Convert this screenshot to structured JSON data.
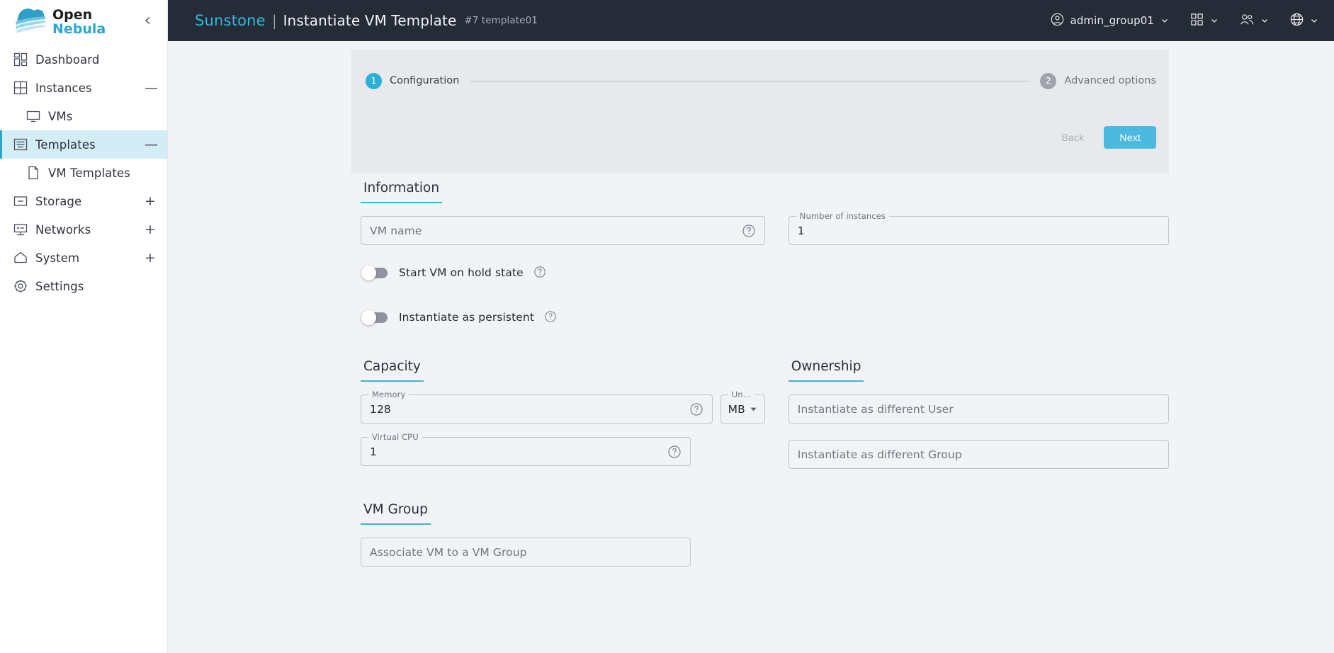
{
  "colors": {
    "accent": "#2ab0d6",
    "accent_button": "#4cb9e0",
    "brand_text": "#30b9dd",
    "topbar_bg": "#262b38",
    "page_bg": "#f1f3f7",
    "panel_bg": "#e7e9ec",
    "sidebar_selected_bg": "#d3edf6"
  },
  "sidebar": {
    "logo_top": "Open",
    "logo_bottom": "Nebula",
    "collapse_icon": "chevron-left-icon",
    "items": [
      {
        "label": "Dashboard",
        "icon": "dashboard-icon",
        "level": 0,
        "expander": "",
        "selected": false
      },
      {
        "label": "Instances",
        "icon": "instances-grid-icon",
        "level": 0,
        "expander": "—",
        "selected": false
      },
      {
        "label": "VMs",
        "icon": "monitor-icon",
        "level": 1,
        "expander": "",
        "selected": false
      },
      {
        "label": "Templates",
        "icon": "templates-icon",
        "level": 0,
        "expander": "—",
        "selected": true
      },
      {
        "label": "VM Templates",
        "icon": "document-icon",
        "level": 1,
        "expander": "",
        "selected": false
      },
      {
        "label": "Storage",
        "icon": "storage-icon",
        "level": 0,
        "expander": "+",
        "selected": false
      },
      {
        "label": "Networks",
        "icon": "network-icon",
        "level": 0,
        "expander": "+",
        "selected": false
      },
      {
        "label": "System",
        "icon": "home-icon",
        "level": 0,
        "expander": "+",
        "selected": false
      },
      {
        "label": "Settings",
        "icon": "gear-icon",
        "level": 0,
        "expander": "",
        "selected": false
      }
    ]
  },
  "topbar": {
    "brand": "Sunstone",
    "separator": "|",
    "title": "Instantiate VM Template",
    "subtitle": "#7 template01",
    "user": {
      "label": "admin_group01",
      "icon": "user-circle-icon",
      "chevron": "chevron-down-icon"
    },
    "apps": {
      "icon": "apps-grid-icon",
      "chevron": "chevron-down-icon"
    },
    "group": {
      "icon": "people-icon",
      "chevron": "chevron-down-icon"
    },
    "language": {
      "icon": "globe-icon",
      "chevron": "chevron-down-icon"
    }
  },
  "stepper": {
    "steps": [
      {
        "number": "1",
        "label": "Configuration",
        "state": "active"
      },
      {
        "number": "2",
        "label": "Advanced options",
        "state": "idle"
      }
    ],
    "back_label": "Back",
    "next_label": "Next"
  },
  "sections": {
    "information": {
      "title": "Information",
      "vm_name": {
        "label": "",
        "placeholder": "VM name",
        "value": "",
        "help_icon": "help-circle-icon"
      },
      "number_of_instances": {
        "label": "Number of instances",
        "value": "1"
      },
      "start_on_hold": {
        "label": "Start VM on hold state",
        "checked": false,
        "help_icon": "help-circle-icon"
      },
      "instantiate_persistent": {
        "label": "Instantiate as persistent",
        "checked": false,
        "help_icon": "help-circle-icon"
      }
    },
    "capacity": {
      "title": "Capacity",
      "memory": {
        "label": "Memory",
        "value": "128",
        "help_icon": "help-circle-icon"
      },
      "memory_unit": {
        "label": "Un…",
        "value": "MB",
        "chevron": "chevron-down-icon"
      },
      "virtual_cpu": {
        "label": "Virtual CPU",
        "value": "1",
        "help_icon": "help-circle-icon"
      }
    },
    "ownership": {
      "title": "Ownership",
      "user": {
        "placeholder": "Instantiate as different User",
        "value": ""
      },
      "group": {
        "placeholder": "Instantiate as different Group",
        "value": ""
      }
    },
    "vm_group": {
      "title": "VM Group",
      "select": {
        "placeholder": "Associate VM to a VM Group",
        "value": ""
      }
    }
  }
}
